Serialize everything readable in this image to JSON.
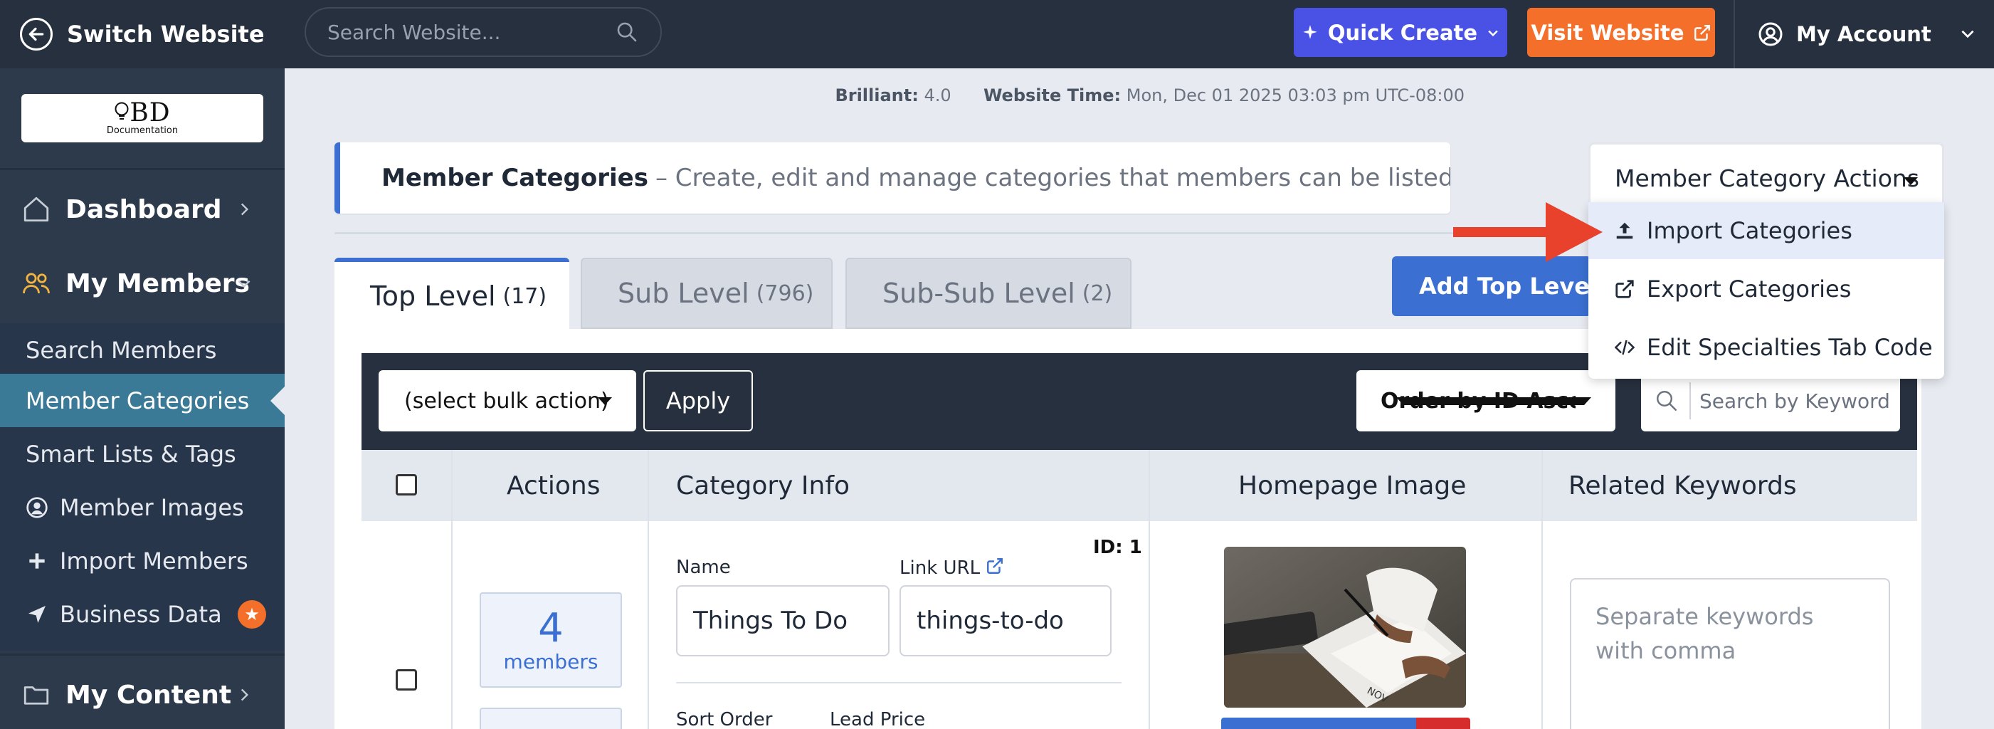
{
  "topbar": {
    "switch_label": "Switch Website",
    "search_placeholder": "Search Website...",
    "quick_create_label": "Quick Create",
    "visit_website_label": "Visit Website",
    "account_label": "My Account",
    "colors": {
      "bar": "#27303e",
      "quick_create": "#4a52e6",
      "visit_website": "#f36f2a"
    }
  },
  "sidebar": {
    "logo_main": "BD",
    "logo_sub": "Documentation",
    "items": [
      {
        "label": "Dashboard",
        "icon": "home-icon"
      },
      {
        "label": "My Members",
        "icon": "users-icon",
        "expanded": true
      },
      {
        "label": "My Content",
        "icon": "folder-icon"
      }
    ],
    "submenu": [
      {
        "label": "Search Members"
      },
      {
        "label": "Member Categories",
        "active": true
      },
      {
        "label": "Smart Lists & Tags"
      },
      {
        "label": "Member Images",
        "icon": "user-circle-icon"
      },
      {
        "label": "Import Members",
        "icon": "plus-icon"
      },
      {
        "label": "Business Data",
        "icon": "location-arrow-icon",
        "badge_icon": "star-icon"
      }
    ]
  },
  "status": {
    "version_label": "Brilliant:",
    "version_value": "4.0",
    "time_label": "Website Time:",
    "time_value": "Mon, Dec 01 2025 03:03 pm UTC-08:00"
  },
  "info_box": {
    "title": "Member Categories",
    "description": "– Create, edit and manage categories that members can be listed in"
  },
  "actions_dropdown": {
    "label": "Member Category Actions",
    "items": [
      {
        "label": "Import Categories",
        "icon": "upload-icon",
        "highlighted": true
      },
      {
        "label": "Export Categories",
        "icon": "external-link-icon"
      },
      {
        "label": "Edit Specialties Tab Code",
        "icon": "code-icon"
      }
    ]
  },
  "tabs": [
    {
      "label": "Top Level",
      "count": "(17)",
      "active": true
    },
    {
      "label": "Sub Level",
      "count": "(796)"
    },
    {
      "label": "Sub-Sub Level",
      "count": "(2)"
    }
  ],
  "add_button_label": "Add Top Level Category",
  "toolbar": {
    "bulk_action_label": "(select bulk action)",
    "apply_label": "Apply",
    "order_label": "Order by ID Ascending",
    "keyword_placeholder": "Search by Keyword"
  },
  "table": {
    "headers": [
      "Actions",
      "Category Info",
      "Homepage Image",
      "Related Keywords"
    ],
    "rows": [
      {
        "member_count": "4",
        "member_label": "members",
        "id_label": "ID: 1",
        "name_label": "Name",
        "name_value": "Things To Do",
        "link_label": "Link URL",
        "link_value": "things-to-do",
        "sort_order_label": "Sort Order",
        "lead_price_label": "Lead Price",
        "keywords_placeholder": "Separate keywords with comma"
      }
    ]
  }
}
